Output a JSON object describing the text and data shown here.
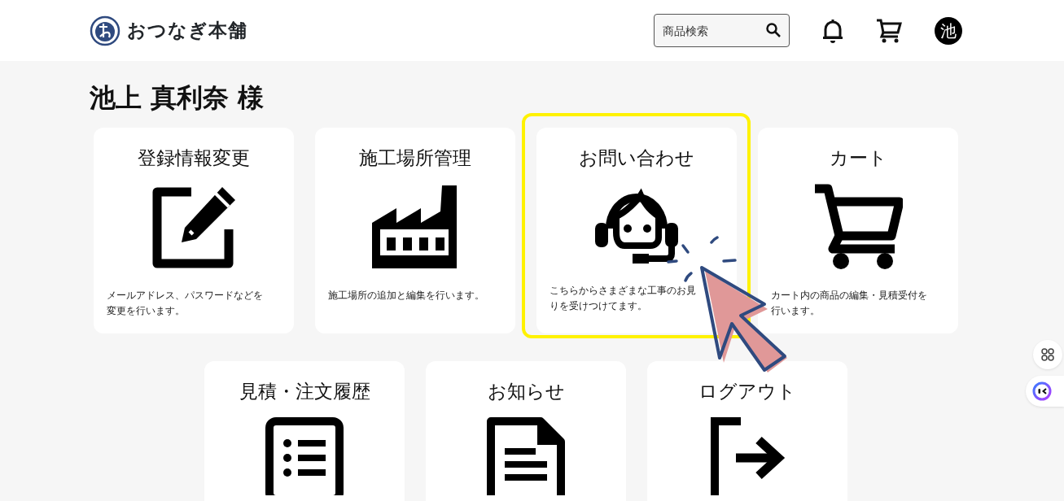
{
  "header": {
    "brand": "おつなぎ本舗",
    "search": {
      "placeholder": "商品検索"
    },
    "avatar": "池"
  },
  "user_name": "池上 真利奈 様",
  "cards": [
    {
      "title": "登録情報変更",
      "kind": "edit",
      "description_lines": [
        "メールアドレス、パスワードなどを",
        "変更を行います。"
      ],
      "highlighted": false
    },
    {
      "title": "施工場所管理",
      "kind": "factory",
      "description_lines": [
        "施工場所の追加と編集を行います。"
      ],
      "highlighted": false
    },
    {
      "title": "お問い合わせ",
      "kind": "headset",
      "description_lines": [
        "こちらからさまざまな工事のお見",
        "りを受けつけてます。"
      ],
      "highlighted": true
    },
    {
      "title": "カート",
      "kind": "cart",
      "description_lines": [
        "カート内の商品の編集・見積受付を",
        "行います。"
      ],
      "highlighted": false
    },
    {
      "title": "見積・注文履歴",
      "kind": "list",
      "highlighted": false
    },
    {
      "title": "お知らせ",
      "kind": "document",
      "highlighted": false
    },
    {
      "title": "ログアウト",
      "kind": "logout",
      "highlighted": false
    }
  ]
}
